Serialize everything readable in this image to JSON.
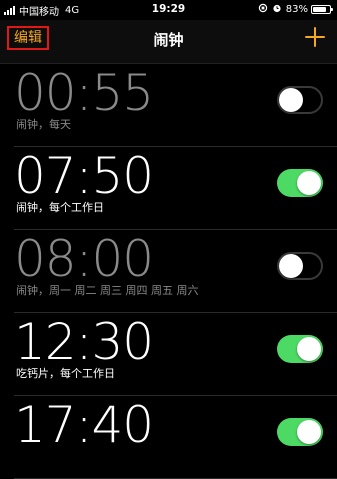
{
  "status_bar": {
    "carrier": "中国移动",
    "network": "4G",
    "time": "19:29",
    "battery_percent": "83%",
    "battery_level": 0.83
  },
  "nav": {
    "edit_label": "编辑",
    "title": "闹钟",
    "add_icon": "plus-icon"
  },
  "colors": {
    "accent": "#f5a623",
    "toggle_on": "#4cd964",
    "highlight_box": "#e01818"
  },
  "alarms": [
    {
      "time": "00:55",
      "label": "闹钟，每天",
      "enabled": false
    },
    {
      "time": "07:50",
      "label": "闹钟，每个工作日",
      "enabled": true
    },
    {
      "time": "08:00",
      "label": "闹钟，周一 周二 周三 周四 周五 周六",
      "enabled": false
    },
    {
      "time": "12:30",
      "label": "吃钙片，每个工作日",
      "enabled": true
    },
    {
      "time": "17:40",
      "label": "",
      "enabled": true
    }
  ]
}
